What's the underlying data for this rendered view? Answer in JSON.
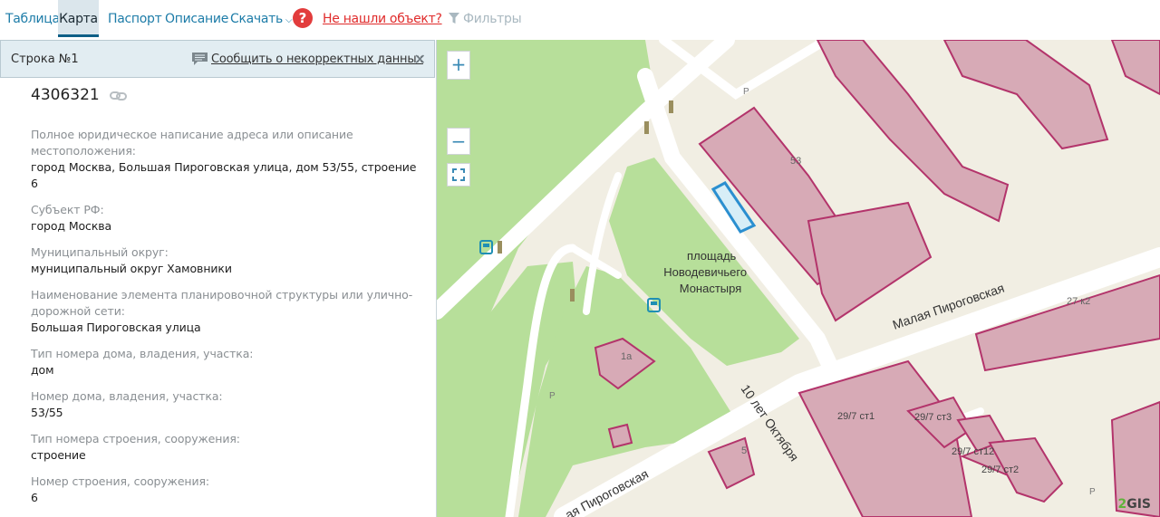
{
  "nav": {
    "tabs": [
      {
        "label": "Таблица"
      },
      {
        "label": "Карта"
      },
      {
        "label": "Паспорт"
      },
      {
        "label": "Описание"
      },
      {
        "label": "Скачать"
      }
    ],
    "help_symbol": "?",
    "not_found": "Не нашли объект?",
    "filters": "Фильтры",
    "active_tab": "Карта"
  },
  "panel": {
    "row_title": "Строка №1",
    "report": "Сообщить о некорректных данных",
    "close_symbol": "✕",
    "object_id": "4306321",
    "fields": [
      {
        "label": "Полное юридическое написание адреса или описание местоположения:",
        "value": "город Москва, Большая Пироговская улица, дом 53/55, строение 6"
      },
      {
        "label": "Субъект РФ:",
        "value": "город Москва"
      },
      {
        "label": "Муниципальный округ:",
        "value": "муниципальный округ Хамовники"
      },
      {
        "label": "Наименование элемента планировочной структуры или улично-дорожной сети:",
        "value": "Большая Пироговская улица"
      },
      {
        "label": "Тип номера дома, владения, участка:",
        "value": "дом"
      },
      {
        "label": "Номер дома, владения, участка:",
        "value": "53/55"
      },
      {
        "label": "Тип номера строения, сооружения:",
        "value": "строение"
      },
      {
        "label": "Номер строения, сооружения:",
        "value": "6"
      }
    ]
  },
  "map": {
    "zoom_in": "+",
    "zoom_out": "−",
    "square_name": "площадь Новодевичьего Монастыря",
    "street_malaya": "Малая Пироговская",
    "street_10let": "10 лет Октября",
    "street_bolshaya": "ая Пироговская",
    "labels": {
      "b53": "53",
      "b1a": "1а",
      "b5": "5",
      "b27k2": "27 к2",
      "b297st1": "29/7 ст1",
      "b297st3": "29/7 ст3",
      "b297st12": "29/7 ст12",
      "b297st2": "29/7 ст2",
      "p": "Р"
    },
    "logo_2": "2",
    "logo_gis": "GIS",
    "colors": {
      "park": "#b7df9a",
      "road": "#ffffff",
      "ground": "#f1eee3",
      "building": "#d7aab6",
      "building_stroke": "#b3346b",
      "highlight": "#2b8fd0"
    }
  }
}
